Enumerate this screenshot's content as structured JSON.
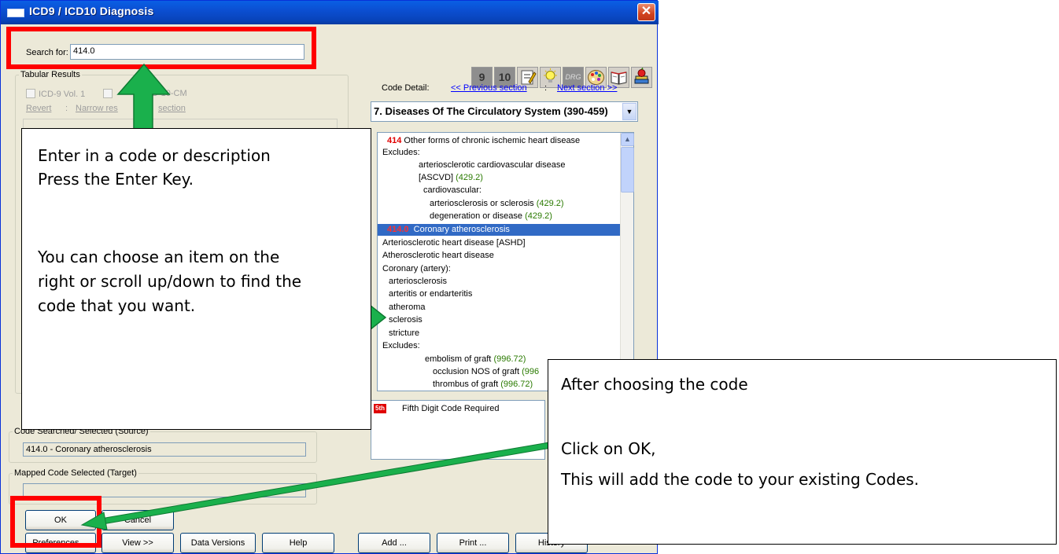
{
  "window": {
    "title": "ICD9 / ICD10 Diagnosis",
    "close_glyph": "✕"
  },
  "search": {
    "label": "Search for:",
    "value": "414.0"
  },
  "toolbar": {
    "icd9": "9",
    "icd10": "10",
    "drg": "DRG"
  },
  "tabular": {
    "legend": "Tabular Results",
    "icd9_label": "ICD-9 Vol. 1",
    "icd10_label": "D-10-CM",
    "revert": "Revert",
    "sep": ":",
    "narrow": "Narrow res",
    "narrow_tail": "section"
  },
  "code_detail": {
    "label": "Code Detail:",
    "prev": "<< Previous section",
    "sep": ":",
    "next": "Next section >>",
    "chapter": "7. Diseases Of The Circulatory System (390-459)",
    "rows": [
      {
        "code": "414",
        "text": "Other forms of chronic ischemic heart disease"
      },
      {
        "text": "Excludes:"
      },
      {
        "text": "arteriosclerotic cardiovascular disease"
      },
      {
        "text": "[ASCVD]",
        "ref": "(429.2)"
      },
      {
        "text": "cardiovascular:"
      },
      {
        "text": "arteriosclerosis or sclerosis",
        "ref": "(429.2)"
      },
      {
        "text": "degeneration or disease",
        "ref": "(429.2)"
      },
      {
        "code": "414.0",
        "text": "Coronary atherosclerosis"
      },
      {
        "text": "Arteriosclerotic heart disease [ASHD]"
      },
      {
        "text": "Atherosclerotic heart disease"
      },
      {
        "text": "Coronary (artery):"
      },
      {
        "text": "arteriosclerosis"
      },
      {
        "text": "arteritis or endarteritis"
      },
      {
        "text": "atheroma"
      },
      {
        "text": "sclerosis"
      },
      {
        "text": "stricture"
      },
      {
        "text": "Excludes:"
      },
      {
        "text": "embolism of graft",
        "ref": "(996.72)"
      },
      {
        "text": "occlusion NOS  of graft",
        "ref": "(996"
      },
      {
        "text": "thrombus of graft",
        "ref": "(996.72)"
      }
    ],
    "fifth_digit_badge": "5th",
    "fifth_digit_note": "Fifth Digit Code Required"
  },
  "source": {
    "legend": "Code Searched/ Selected (Source)",
    "value": "414.0 - Coronary atherosclerosis"
  },
  "target": {
    "legend": "Mapped Code Selected (Target)",
    "value": ""
  },
  "buttons": {
    "ok": "OK",
    "cancel": "Cancel",
    "preferences": "Preferences ...",
    "view": "View >>",
    "data_versions": "Data Versions",
    "help": "Help",
    "add": "Add ...",
    "print": "Print ...",
    "history": "History"
  },
  "callouts": {
    "left": {
      "line1": "Enter in a code or description",
      "line2": "Press the Enter Key.",
      "line3": "You can choose an item on the",
      "line4": "right or scroll up/down to find the",
      "line5": "code that you want."
    },
    "right": {
      "line1": "After choosing the code",
      "line2": "Click on OK,",
      "line3": "This will add the code to your existing Codes."
    }
  },
  "colors": {
    "arrow": "#1ab04c",
    "highlight": "#ff0000",
    "selection": "#316ac5"
  }
}
